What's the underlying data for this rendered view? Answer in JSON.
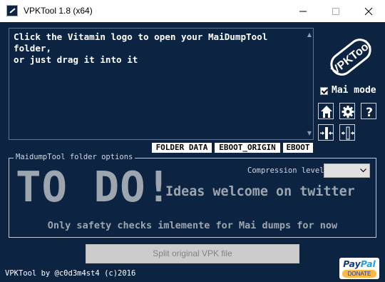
{
  "window": {
    "title": "VPKTool 1.8 (x64)"
  },
  "main_panel": {
    "text": "Click the Vitamin logo to open your MaiDumpTool folder,\nor just drag it into it"
  },
  "logo": {
    "text": "VPKTool"
  },
  "mai_mode": {
    "label": "Mai mode",
    "checked": true
  },
  "tool_icons": [
    "home-icon",
    "gear-icon",
    "help-icon",
    "compress-icon",
    "extract-icon"
  ],
  "tags": {
    "folder_data": "FOLDER DATA",
    "eboot_origin": "EBOOT_ORIGIN",
    "eboot": "EBOOT"
  },
  "maidump": {
    "legend": "MaidumpTool folder options",
    "compression_label": "Compression level",
    "compression_value": "",
    "todo": "TO DO!",
    "ideas": "Ideas welcome on twitter",
    "safety_note": "Only safety checks imlemente for Mai dumps for now"
  },
  "split_button": {
    "label": "Split original VPK file"
  },
  "footer": {
    "credit": "VPKTool by @c0d3m4st4 (c)2016",
    "paypal_word_pay": "Pay",
    "paypal_word_pal": "Pal",
    "donate": "DONATE"
  },
  "colors": {
    "background": "#0c2442",
    "text_white": "#ffffff",
    "text_muted": "#9da5ae",
    "paypal_dark": "#1a3b80",
    "paypal_light": "#2a9fd6",
    "paypal_button": "#fdb846"
  }
}
